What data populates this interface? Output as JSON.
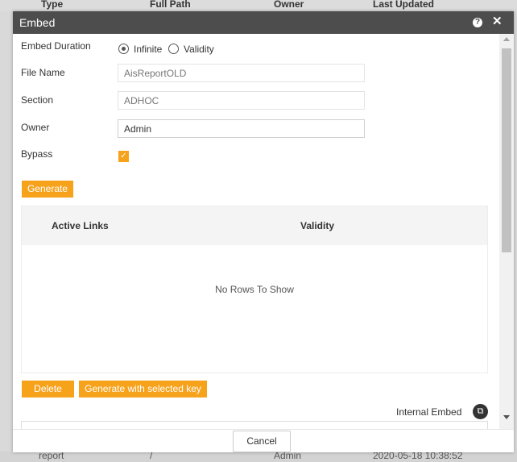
{
  "background": {
    "columns": [
      "Type",
      "Full Path",
      "Owner",
      "Last Updated"
    ],
    "bottom_row": [
      "report",
      "/",
      "Admin",
      "2020-05-18 10:38:52"
    ]
  },
  "modal": {
    "title": "Embed",
    "help_icon": "question-circle-icon",
    "close_icon": "close-icon"
  },
  "form": {
    "embed_duration_label": "Embed Duration",
    "duration_options": [
      {
        "label": "Infinite",
        "selected": true
      },
      {
        "label": "Validity",
        "selected": false
      }
    ],
    "file_name_label": "File Name",
    "file_name_value": "AisReportOLD",
    "section_label": "Section",
    "section_value": "ADHOC",
    "owner_label": "Owner",
    "owner_value": "Admin",
    "bypass_label": "Bypass",
    "bypass_checked": true
  },
  "buttons": {
    "generate": "Generate",
    "delete": "Delete",
    "generate_with_key": "Generate with selected key",
    "cancel": "Cancel"
  },
  "links_table": {
    "columns": [
      "Active Links",
      "Validity"
    ],
    "empty_text": "No Rows To Show"
  },
  "internal_embed_label": "Internal Embed",
  "colors": {
    "accent": "#f7a21b",
    "title_bar": "#4d4d4d"
  }
}
